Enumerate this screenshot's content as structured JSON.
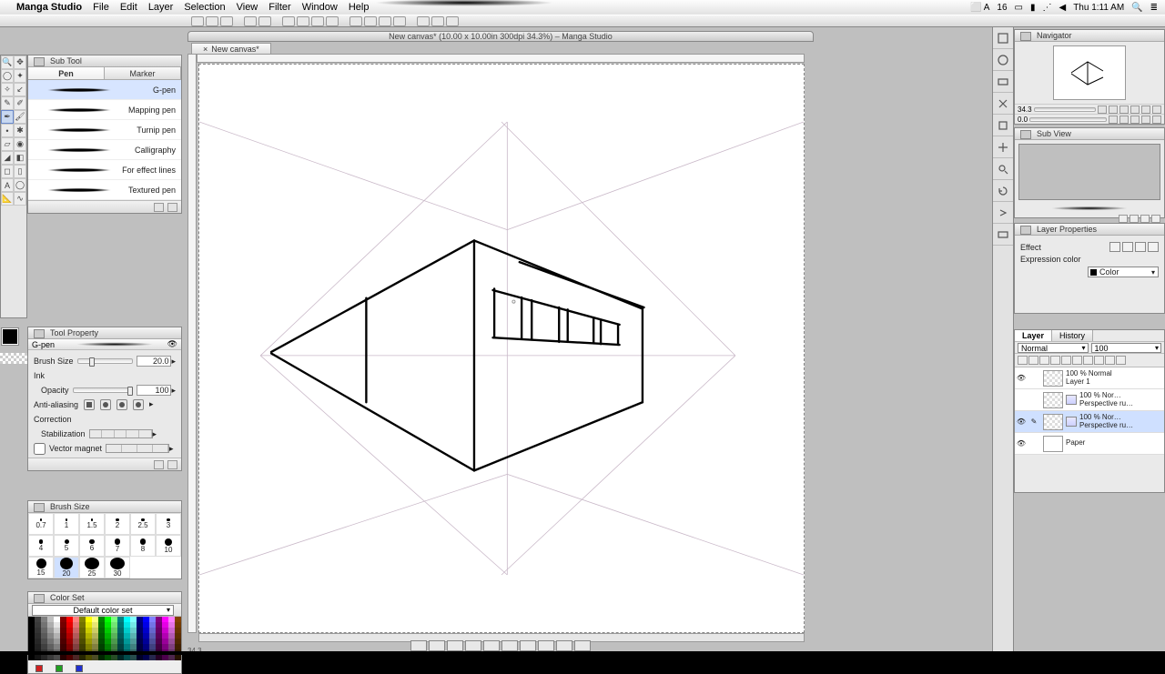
{
  "menubar": {
    "app_name": "Manga Studio",
    "items": [
      "File",
      "Edit",
      "Layer",
      "Selection",
      "View",
      "Filter",
      "Window",
      "Help"
    ],
    "status_badge": "16",
    "clock": "Thu 1:11 AM"
  },
  "document": {
    "title": "New canvas* (10.00 x 10.00in 300dpi 34.3%)  –  Manga Studio",
    "tab_label": "New canvas*",
    "zoom_status": "34.3"
  },
  "subtool": {
    "panel_title": "Sub Tool",
    "tabs": [
      "Pen",
      "Marker"
    ],
    "active_tab": 0,
    "brushes": [
      "G-pen",
      "Mapping pen",
      "Turnip pen",
      "Calligraphy",
      "For effect lines",
      "Textured pen"
    ],
    "selected_brush": 0
  },
  "toolprop": {
    "panel_title": "Tool Property",
    "subtool_name": "G-pen",
    "brush_size_label": "Brush Size",
    "brush_size_value": "20.0",
    "ink_label": "Ink",
    "opacity_label": "Opacity",
    "opacity_value": "100",
    "aa_label": "Anti-aliasing",
    "correction_label": "Correction",
    "stabilization_label": "Stabilization",
    "vector_magnet_label": "Vector magnet"
  },
  "brushsize": {
    "panel_title": "Brush Size",
    "sizes": [
      "0.7",
      "1",
      "1.5",
      "2",
      "2.5",
      "3",
      "4",
      "5",
      "6",
      "7",
      "8",
      "10",
      "15",
      "20",
      "25",
      "30"
    ],
    "selected_index": 13
  },
  "colorset": {
    "panel_title": "Color Set",
    "combo_value": "Default color set",
    "mini": [
      "#d02020",
      "#20a020",
      "#2030d0"
    ]
  },
  "navigator": {
    "panel_title": "Navigator",
    "zoom_value": "34.3"
  },
  "subview": {
    "panel_title": "Sub View"
  },
  "layerprops": {
    "panel_title": "Layer Properties",
    "effect_label": "Effect",
    "expr_label": "Expression color",
    "expr_value": "Color"
  },
  "layers": {
    "tab_layer": "Layer",
    "tab_history": "History",
    "blend_mode": "Normal",
    "opacity": "100",
    "rows": [
      {
        "name": "100 % Normal",
        "sub": "Layer 1",
        "visible": true,
        "ruler": false,
        "paper": false,
        "sel": false
      },
      {
        "name": "100 % Nor…",
        "sub": "Perspective ru…",
        "visible": false,
        "ruler": true,
        "paper": false,
        "sel": false
      },
      {
        "name": "100 % Nor…",
        "sub": "Perspective ru…",
        "visible": true,
        "ruler": true,
        "paper": false,
        "sel": true
      },
      {
        "name": "",
        "sub": "Paper",
        "visible": true,
        "ruler": false,
        "paper": true,
        "sel": false
      }
    ]
  }
}
